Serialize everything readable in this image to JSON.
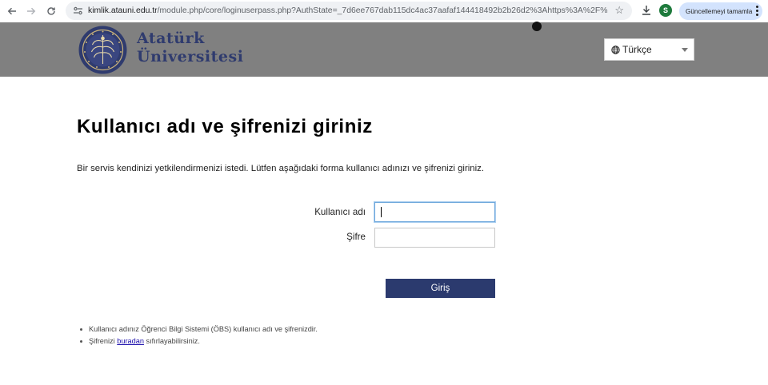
{
  "browser": {
    "url_host": "kimlik.atauni.edu.tr",
    "url_rest": "/module.php/core/loginuserpass.php?AuthState=_7d6ee767dab115dc4ac37aafaf144418492b2b26d2%3Ahttps%3A%2F%2Fkimlik...",
    "profile_initial": "S",
    "update_label": "Güncellemeyi tamamla"
  },
  "header": {
    "brand_line1": "Atatürk",
    "brand_line2": "Üniversitesi",
    "language_selected": "Türkçe"
  },
  "main": {
    "heading": "Kullanıcı adı ve şifrenizi giriniz",
    "intro": "Bir servis kendinizi yetkilendirmenizi istedi. Lütfen aşağıdaki forma kullanıcı adınızı ve şifrenizi giriniz.",
    "username_label": "Kullanıcı adı",
    "username_value": "",
    "password_label": "Şifre",
    "password_value": "",
    "submit_label": "Giriş"
  },
  "notes": {
    "item1": "Kullanıcı adınız Öğrenci Bilgi Sistemi (ÖBS) kullanıcı adı ve şifrenizdir.",
    "item2_prefix": "Şifrenizi ",
    "item2_link": "buradan",
    "item2_suffix": " sıfırlayabilirsiniz."
  },
  "icons": [
    "back-arrow-icon",
    "forward-arrow-icon",
    "reload-icon",
    "site-info-icon",
    "star-icon",
    "download-icon",
    "globe-icon",
    "chevron-down-icon",
    "menu-kebab-icon",
    "university-seal-logo"
  ],
  "colors": {
    "header_bg": "#808080",
    "brand_text": "#2f3b6e",
    "button_bg": "#2b3a6e",
    "input_focus": "#6fa8dc"
  }
}
